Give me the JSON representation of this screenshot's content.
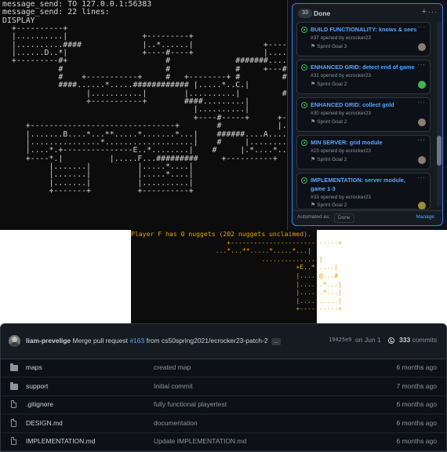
{
  "terminal_server": {
    "lines": [
      "message_send: TO 127.0.0.1:56383",
      "message_send: 22 lines:",
      "DISPLAY",
      "  +----------+",
      "  |..........|                +---------+",
      "  |..........####             |..*......|               +-------+",
      "  |......D..*|                +----#----+               |.......|",
      "  +---------#+                     #              #######.......|",
      "            #                      #              #     +---#---+",
      "            #    +-----------+     #   +--------+ #         #",
      "            ####......*.....############ |.....*..C.|         #",
      "                  |...........|        |..........|         #",
      "                  +-----------+        ####.........|         #",
      "                                         |..........|         #",
      "                                         +----#-----+      +------#--+",
      "     +-------------------------------+        #            |.*........|",
      "     |.......B....*...**.....*.......*...|    ######....A........|",
      "     |...............*...................|    #     |...........|",
      "     |....*.+---------------E..*........|    #     |.*....*....|",
      "     +----*.|          |.....F...#########     +----------+",
      "          |.......|          |.....*....|",
      "          |.......|          |.....*....|",
      "          |.......|          |..........|",
      "          +-------+          +----------+"
    ]
  },
  "board": {
    "count": "33",
    "title": "Done",
    "cards": [
      {
        "title": "BUILD FUNCTIONALITY: knows & sees",
        "meta": "#37 opened by ecrocker23",
        "milestone": "Sprint Goal 3",
        "avatar_color": "#8a7e72"
      },
      {
        "title": "ENHANCED GRID: detect end of game",
        "meta": "#31 opened by ecrocker23",
        "milestone": "Sprint Goal 2",
        "avatar_color": "#3fb950"
      },
      {
        "title": "ENHANCED GRID: collect gold",
        "meta": "#30 opened by ecrocker23",
        "milestone": "Sprint Goal 2",
        "avatar_color": "#8a7e72"
      },
      {
        "title": "MIN SERVER: grid module",
        "meta": "#23 opened by ecrocker23",
        "milestone": "Sprint Goal 2",
        "avatar_color": "#8a7e72"
      },
      {
        "title": "IMPLEMENTATION: server module, game 1-3",
        "meta": "#33 opened by ecrocker23",
        "milestone": "Sprint Goal 2",
        "avatar_color": "#9a8b3a"
      }
    ],
    "automation_label": "Automated as:",
    "automation_value": "Done",
    "manage_label": "Manage"
  },
  "terminal_player": {
    "lines": [
      "Player F has 0 nuggets (202 nuggets unclaimed).",
      "                         +----------------------------+",
      "                      ...*...**.....*.....*...|",
      "                                  ...............|",
      "                                           +E..*.....|",
      "                                           |.....@...#",
      "                                           |......*...|",
      "                                           |......*...|",
      "                                           |..........|",
      "                                           +----------+"
    ]
  },
  "repo": {
    "author": "liam-prevelige",
    "commit_prefix": "Merge pull request",
    "pr_link": "#163",
    "commit_suffix": "from cs50spring2021/ecrocker23-patch-2",
    "ellipsis": "...",
    "hash": "19425e9",
    "date": "on Jun 1",
    "commit_count": "333",
    "commits_label": "commits",
    "files": [
      {
        "type": "folder",
        "name": "maps",
        "message": "created map",
        "date": "6 months ago"
      },
      {
        "type": "folder",
        "name": "support",
        "message": "Initial commit",
        "date": "7 months ago"
      },
      {
        "type": "file",
        "name": ".gitignore",
        "message": "fully functional playertest",
        "date": "6 months ago"
      },
      {
        "type": "file",
        "name": "DESIGN.md",
        "message": "documentation",
        "date": "6 months ago"
      },
      {
        "type": "file",
        "name": "IMPLEMENTATION.md",
        "message": "Update IMPLEMENTATION.md",
        "date": "6 months ago"
      }
    ]
  }
}
